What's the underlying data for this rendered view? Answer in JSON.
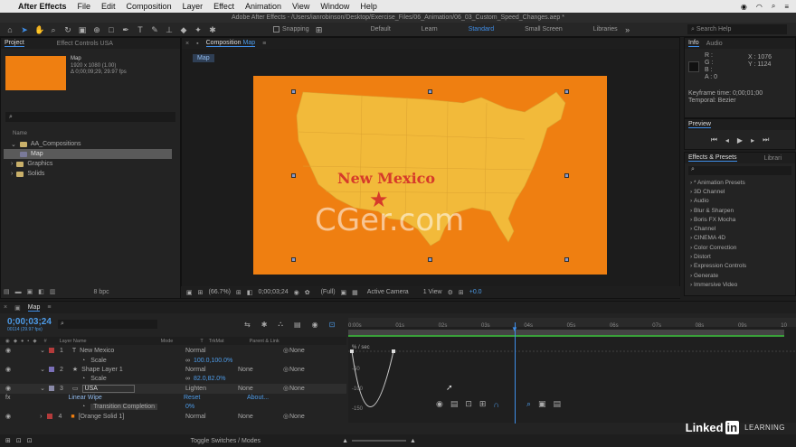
{
  "menubar": {
    "app_name": "After Effects",
    "items": [
      "File",
      "Edit",
      "Composition",
      "Layer",
      "Effect",
      "Animation",
      "View",
      "Window",
      "Help"
    ]
  },
  "window_title": "Adobe After Effects - /Users/ianrobinson/Desktop/Exercise_Files/06_Animation/06_03_Custom_Speed_Changes.aep *",
  "toolbar": {
    "snapping": "Snapping",
    "workspaces": [
      "Default",
      "Learn",
      "Standard",
      "Small Screen",
      "Libraries"
    ],
    "active_workspace": "Standard",
    "search_placeholder": "Search Help"
  },
  "project": {
    "tabs": [
      "Project",
      "Effect Controls USA"
    ],
    "item_name": "Map",
    "item_size": "1920 x 1080 (1.00)",
    "item_duration": "Δ 0;00;09;29, 29.97 fps",
    "column_name": "Name",
    "tree": [
      {
        "label": "AA_Compositions",
        "type": "folder"
      },
      {
        "label": "Map",
        "type": "comp",
        "selected": true
      },
      {
        "label": "Graphics",
        "type": "folder"
      },
      {
        "label": "Solids",
        "type": "folder"
      }
    ],
    "bpc": "8 bpc"
  },
  "composition": {
    "tab_prefix": "Composition",
    "tab_name": "Map",
    "flow_tab": "Map",
    "map_label": "New Mexico",
    "colors": {
      "background": "#ef7f11",
      "map": "#f2ba3a",
      "label": "#d63a2a"
    },
    "footer": {
      "zoom": "(66.7%)",
      "timecode": "0;00;03;24",
      "resolution": "(Full)",
      "camera": "Active Camera",
      "view": "1 View",
      "exposure": "+0.0"
    }
  },
  "info": {
    "tabs": [
      "Info",
      "Audio"
    ],
    "r": "R :",
    "g": "G :",
    "b": "B :",
    "a": "A : 0",
    "x": "X : 1076",
    "y": "Y : 1124",
    "keyframe_time": "Keyframe time: 0;00;01;00",
    "temporal": "Temporal: Bezier"
  },
  "preview": {
    "title": "Preview"
  },
  "effects": {
    "tabs": [
      "Effects & Presets",
      "Librari"
    ],
    "items": [
      "* Animation Presets",
      "3D Channel",
      "Audio",
      "Blur & Sharpen",
      "Boris FX Mocha",
      "Channel",
      "CINEMA 4D",
      "Color Correction",
      "Distort",
      "Expression Controls",
      "Generate",
      "Immersive Video"
    ]
  },
  "timeline": {
    "comp_tab": "Map",
    "timecode": "0;00;03;24",
    "fps_line": "00114 (29.97 fps)",
    "columns": {
      "num": "#",
      "layer_name": "Layer Name",
      "mode": "Mode",
      "t": "T",
      "trkmat": "TrkMat",
      "parent": "Parent & Link"
    },
    "layers": [
      {
        "num": "1",
        "icon": "T",
        "name": "New Mexico",
        "mode": "Normal",
        "trkmat": "",
        "parent": "None",
        "color": "#b43b3b"
      },
      {
        "prop": "Scale",
        "value": "100.0,100.0%"
      },
      {
        "num": "2",
        "icon": "★",
        "name": "Shape Layer 1",
        "mode": "Normal",
        "trkmat": "None",
        "parent": "None",
        "color": "#7a6fb8"
      },
      {
        "prop": "Scale",
        "value": "82.0,82.0%"
      },
      {
        "num": "3",
        "icon": "▭",
        "name": "USA",
        "mode": "Lighten",
        "trkmat": "None",
        "parent": "None",
        "color": "#8a8aa8"
      },
      {
        "effect": "Linear Wipe",
        "reset": "Reset",
        "about": "About..."
      },
      {
        "prop": "Transition Completion",
        "value": "0%"
      },
      {
        "num": "4",
        "icon": "■",
        "name": "[Orange Solid 1]",
        "mode": "Normal",
        "trkmat": "None",
        "parent": "None",
        "color": "#b43b3b"
      }
    ],
    "ruler": [
      "0:00s",
      "01s",
      "02s",
      "03s",
      "04s",
      "05s",
      "06s",
      "07s",
      "08s",
      "09s",
      "10"
    ],
    "graph_unit": "% / sec",
    "graph_values": [
      "-50",
      "-100",
      "-150"
    ],
    "toggle_label": "Toggle Switches / Modes"
  },
  "watermark": "CGer.com",
  "branding": {
    "linked": "Linked",
    "in": "in",
    "learning": "LEARNING"
  }
}
